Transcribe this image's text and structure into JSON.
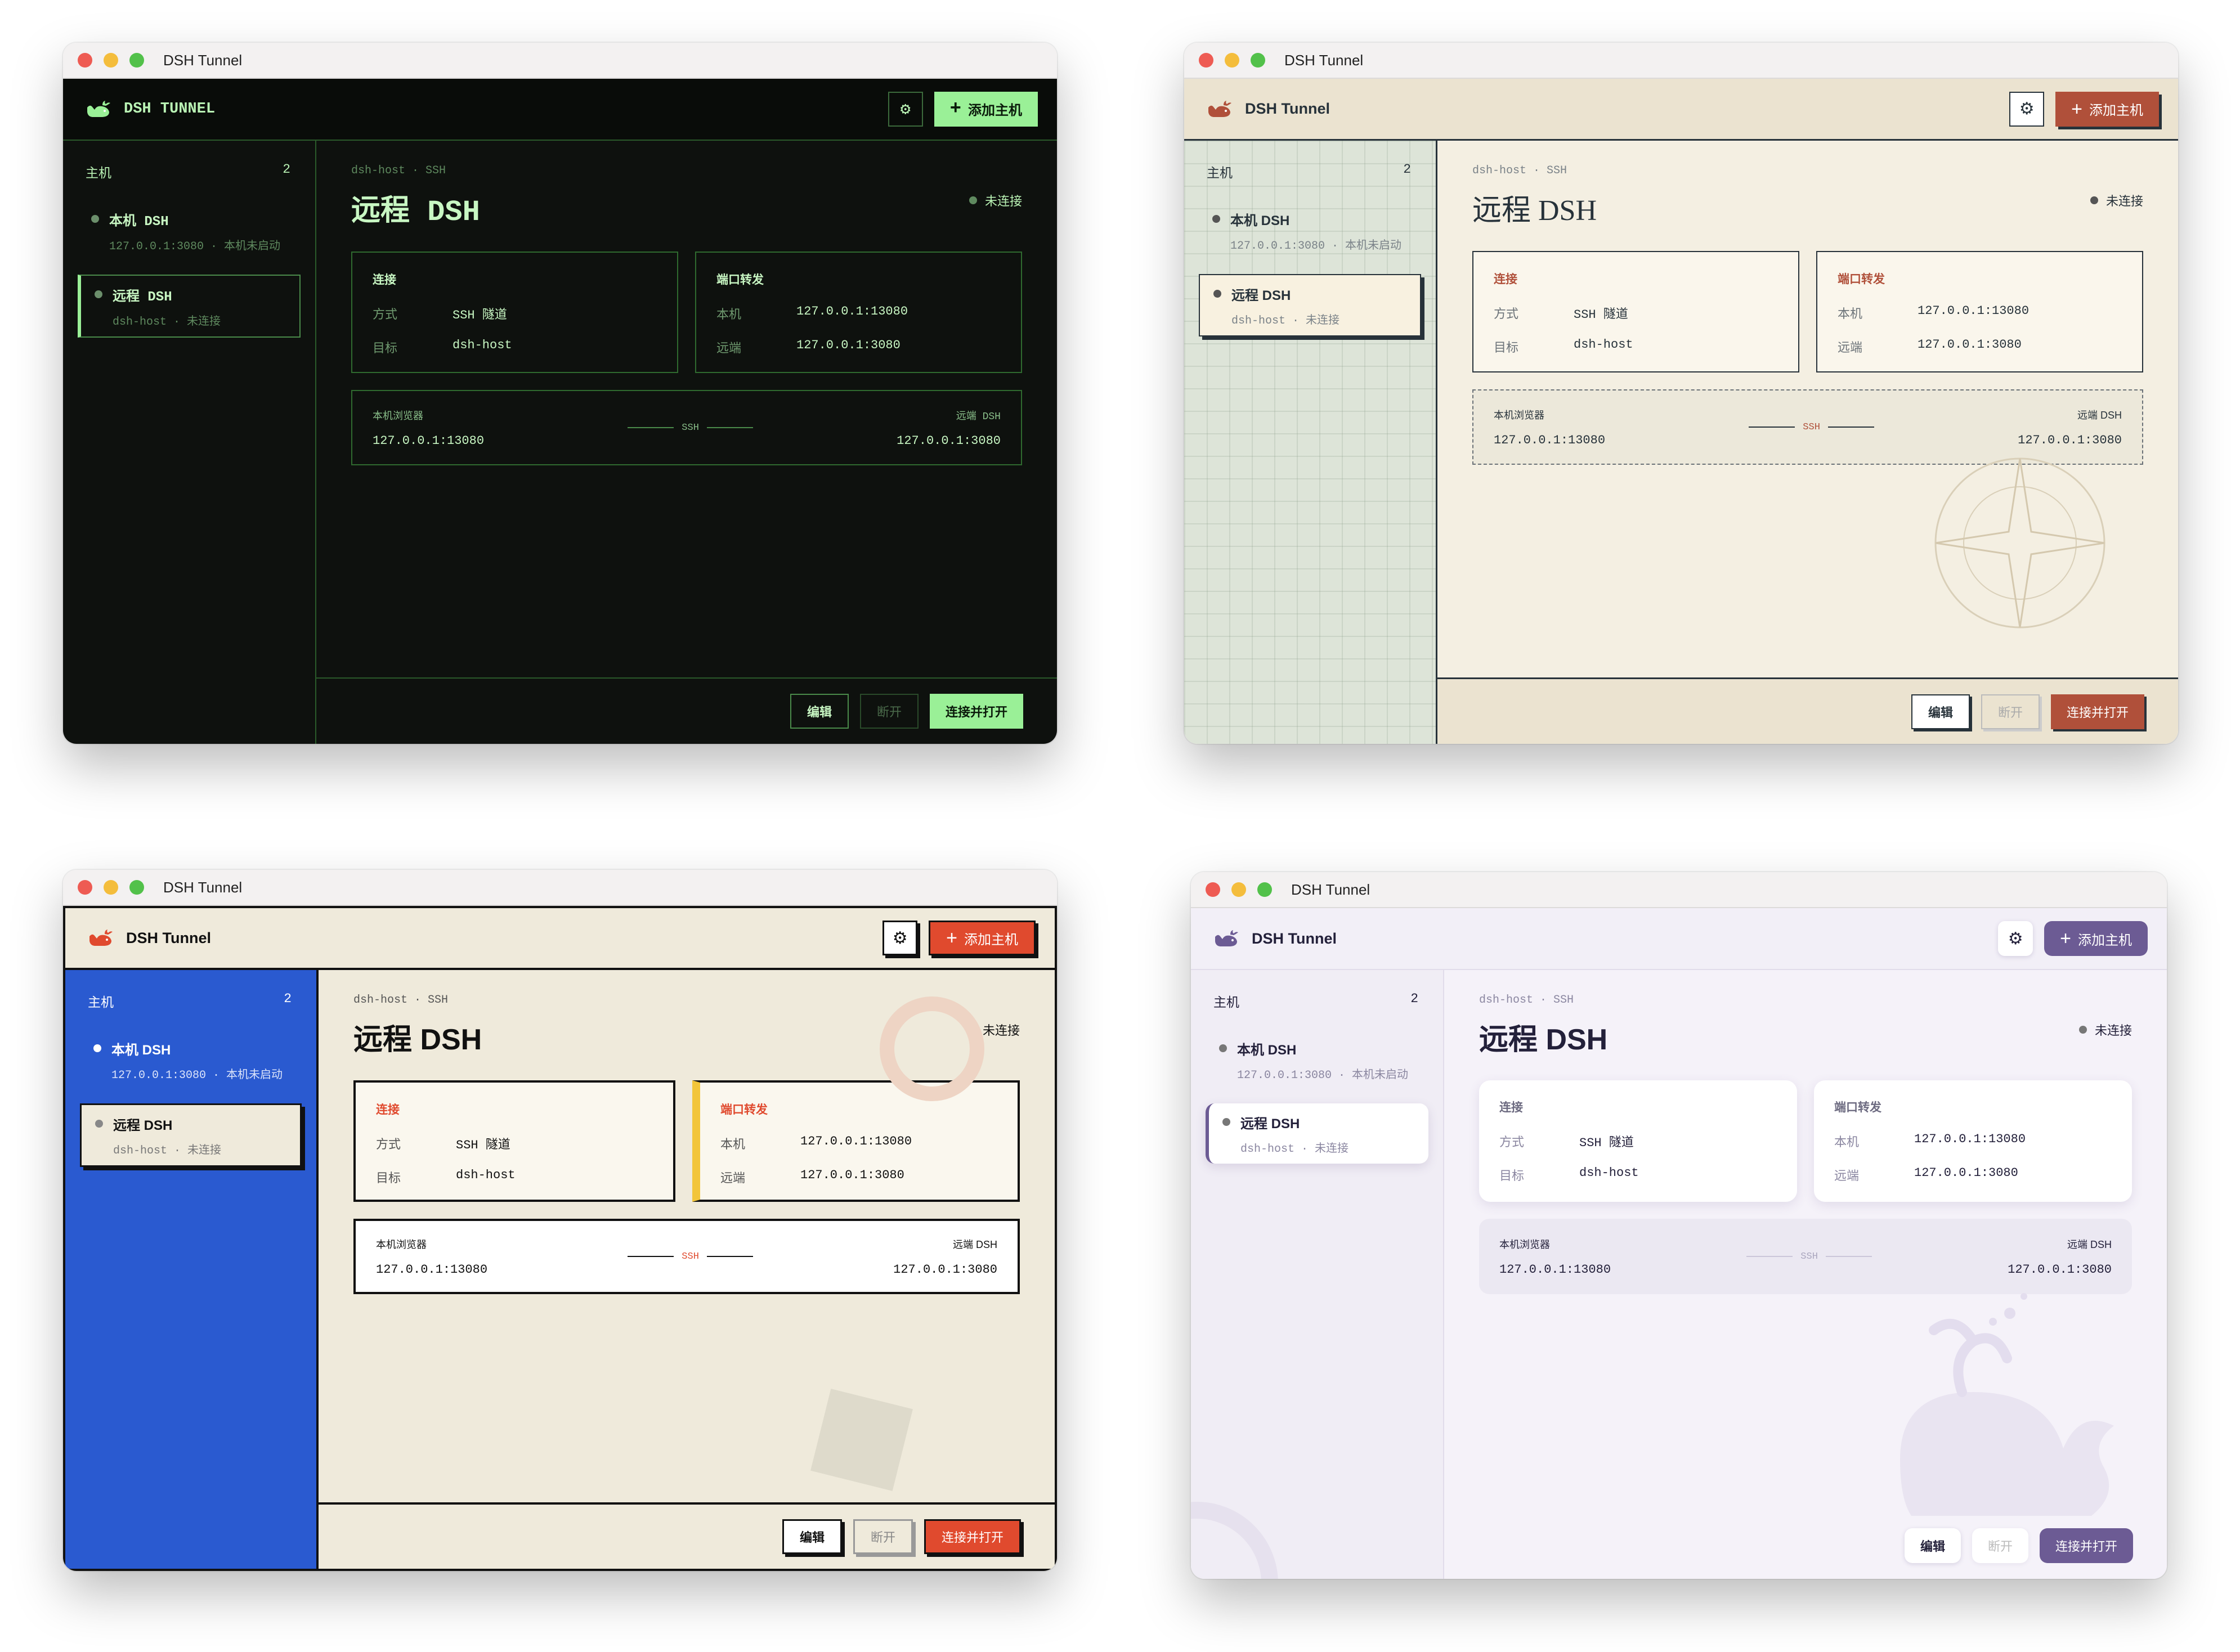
{
  "windows": [
    {
      "window_title": "DSH Tunnel",
      "brand": "DSH TUNNEL",
      "add_label": "添加主机",
      "sidebar": {
        "header": "主机",
        "count": "2",
        "items": [
          {
            "name": "本机 DSH",
            "sub": "127.0.0.1:3080 · 本机未启动"
          },
          {
            "name": "远程 DSH",
            "sub": "dsh-host · 未连接"
          }
        ]
      },
      "main": {
        "breadcrumb": "dsh-host · SSH",
        "title": "远程 DSH",
        "status": "未连接",
        "connection": {
          "title": "连接",
          "rows": [
            {
              "k": "方式",
              "v": "SSH 隧道"
            },
            {
              "k": "目标",
              "v": "dsh-host"
            }
          ]
        },
        "forward": {
          "title": "端口转发",
          "rows": [
            {
              "k": "本机",
              "v": "127.0.0.1:13080"
            },
            {
              "k": "远端",
              "v": "127.0.0.1:3080"
            }
          ]
        },
        "route": {
          "left_label": "本机浏览器",
          "left_value": "127.0.0.1:13080",
          "mid": "SSH",
          "right_label": "远端 DSH",
          "right_value": "127.0.0.1:3080"
        }
      },
      "footer": {
        "edit": "编辑",
        "disconnect": "断开",
        "primary": "连接并打开"
      }
    },
    {
      "window_title": "DSH Tunnel",
      "brand": "DSH Tunnel",
      "add_label": "添加主机",
      "sidebar": {
        "header": "主机",
        "count": "2",
        "items": [
          {
            "name": "本机 DSH",
            "sub": "127.0.0.1:3080 · 本机未启动"
          },
          {
            "name": "远程 DSH",
            "sub": "dsh-host · 未连接"
          }
        ]
      },
      "main": {
        "breadcrumb": "dsh-host · SSH",
        "title": "远程 DSH",
        "status": "未连接",
        "connection": {
          "title": "连接",
          "rows": [
            {
              "k": "方式",
              "v": "SSH 隧道"
            },
            {
              "k": "目标",
              "v": "dsh-host"
            }
          ]
        },
        "forward": {
          "title": "端口转发",
          "rows": [
            {
              "k": "本机",
              "v": "127.0.0.1:13080"
            },
            {
              "k": "远端",
              "v": "127.0.0.1:3080"
            }
          ]
        },
        "route": {
          "left_label": "本机浏览器",
          "left_value": "127.0.0.1:13080",
          "mid": "SSH",
          "right_label": "远端 DSH",
          "right_value": "127.0.0.1:3080"
        }
      },
      "footer": {
        "edit": "编辑",
        "disconnect": "断开",
        "primary": "连接并打开"
      }
    },
    {
      "window_title": "DSH Tunnel",
      "brand": "DSH Tunnel",
      "add_label": "添加主机",
      "sidebar": {
        "header": "主机",
        "count": "2",
        "items": [
          {
            "name": "本机 DSH",
            "sub": "127.0.0.1:3080 · 本机未启动"
          },
          {
            "name": "远程 DSH",
            "sub": "dsh-host · 未连接"
          }
        ]
      },
      "main": {
        "breadcrumb": "dsh-host · SSH",
        "title": "远程 DSH",
        "status": "未连接",
        "connection": {
          "title": "连接",
          "rows": [
            {
              "k": "方式",
              "v": "SSH 隧道"
            },
            {
              "k": "目标",
              "v": "dsh-host"
            }
          ]
        },
        "forward": {
          "title": "端口转发",
          "rows": [
            {
              "k": "本机",
              "v": "127.0.0.1:13080"
            },
            {
              "k": "远端",
              "v": "127.0.0.1:3080"
            }
          ]
        },
        "route": {
          "left_label": "本机浏览器",
          "left_value": "127.0.0.1:13080",
          "mid": "SSH",
          "right_label": "远端 DSH",
          "right_value": "127.0.0.1:3080"
        }
      },
      "footer": {
        "edit": "编辑",
        "disconnect": "断开",
        "primary": "连接并打开"
      }
    },
    {
      "window_title": "DSH Tunnel",
      "brand": "DSH Tunnel",
      "add_label": "添加主机",
      "sidebar": {
        "header": "主机",
        "count": "2",
        "items": [
          {
            "name": "本机 DSH",
            "sub": "127.0.0.1:3080 · 本机未启动"
          },
          {
            "name": "远程 DSH",
            "sub": "dsh-host · 未连接"
          }
        ]
      },
      "main": {
        "breadcrumb": "dsh-host · SSH",
        "title": "远程 DSH",
        "status": "未连接",
        "connection": {
          "title": "连接",
          "rows": [
            {
              "k": "方式",
              "v": "SSH 隧道"
            },
            {
              "k": "目标",
              "v": "dsh-host"
            }
          ]
        },
        "forward": {
          "title": "端口转发",
          "rows": [
            {
              "k": "本机",
              "v": "127.0.0.1:13080"
            },
            {
              "k": "远端",
              "v": "127.0.0.1:3080"
            }
          ]
        },
        "route": {
          "left_label": "本机浏览器",
          "left_value": "127.0.0.1:13080",
          "mid": "SSH",
          "right_label": "远端 DSH",
          "right_value": "127.0.0.1:3080"
        }
      },
      "footer": {
        "edit": "编辑",
        "disconnect": "断开",
        "primary": "连接并打开"
      }
    }
  ],
  "themes": [
    {
      "name": "terminal",
      "accent": "#9af097",
      "background": "#0e110e"
    },
    {
      "name": "parchment",
      "accent": "#b0503a",
      "background": "#f4efe2"
    },
    {
      "name": "bold-blue",
      "accent": "#e04a2e",
      "sidebar": "#2a5ad0",
      "background": "#efeadb"
    },
    {
      "name": "lavender",
      "accent": "#6c5b94",
      "background": "#f5f2f9"
    }
  ],
  "icons": {
    "logo": "whale-icon",
    "settings": "gear-icon",
    "add": "plus-icon",
    "status": "status-dot-icon"
  }
}
